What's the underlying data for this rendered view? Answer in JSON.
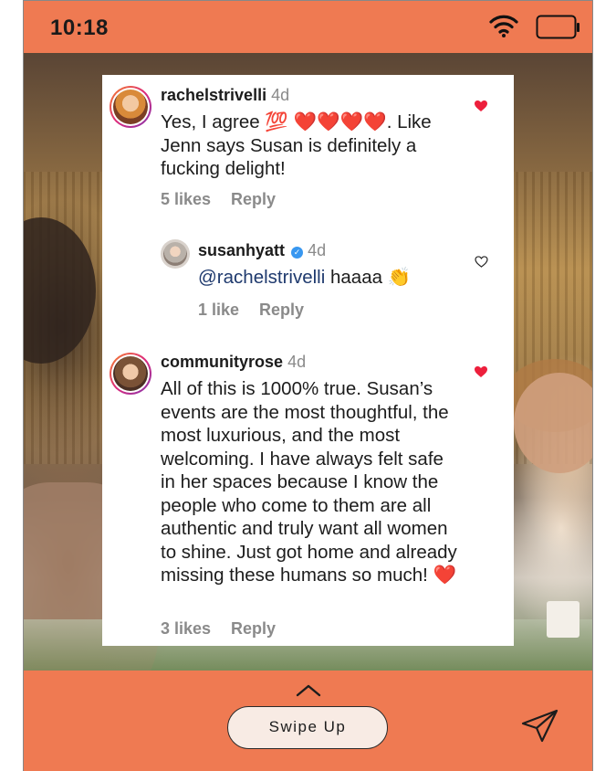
{
  "status_bar": {
    "time": "10:18"
  },
  "comments": [
    {
      "username": "rachelstrivelli",
      "age": "4d",
      "text_prefix": "Yes, I agree 💯 ",
      "text_hearts": "❤️❤️❤️❤️",
      "text_suffix": ". Like Jenn says Susan is definitely a fucking delight!",
      "likes": "5 likes",
      "reply": "Reply",
      "liked": true
    },
    {
      "username": "susanhyatt",
      "verified": true,
      "age": "4d",
      "mention": "@rachelstrivelli",
      "text": " haaaa 👏",
      "likes": "1 like",
      "reply": "Reply",
      "liked": false
    },
    {
      "username": "communityrose",
      "age": "4d",
      "text": "All of this is 1000% true. Susan’s events are the most thoughtful, the most luxurious, and the most welcoming. I have always felt safe in her spaces because I know the people who come to them are all authentic and truly want all women to shine. Just got home and already missing these humans so much! ",
      "text_heart": "❤️",
      "likes": "3 likes",
      "reply": "Reply",
      "liked": true
    }
  ],
  "bottom": {
    "swipe_label": "Swipe Up"
  },
  "colors": {
    "brand_orange": "#ef7a52",
    "like_red": "#ed1f3c",
    "mention_blue": "#1f3a6e"
  },
  "icons": [
    "wifi-icon",
    "battery-icon",
    "heart-icon",
    "verified-icon",
    "chevron-up-icon",
    "send-icon"
  ]
}
